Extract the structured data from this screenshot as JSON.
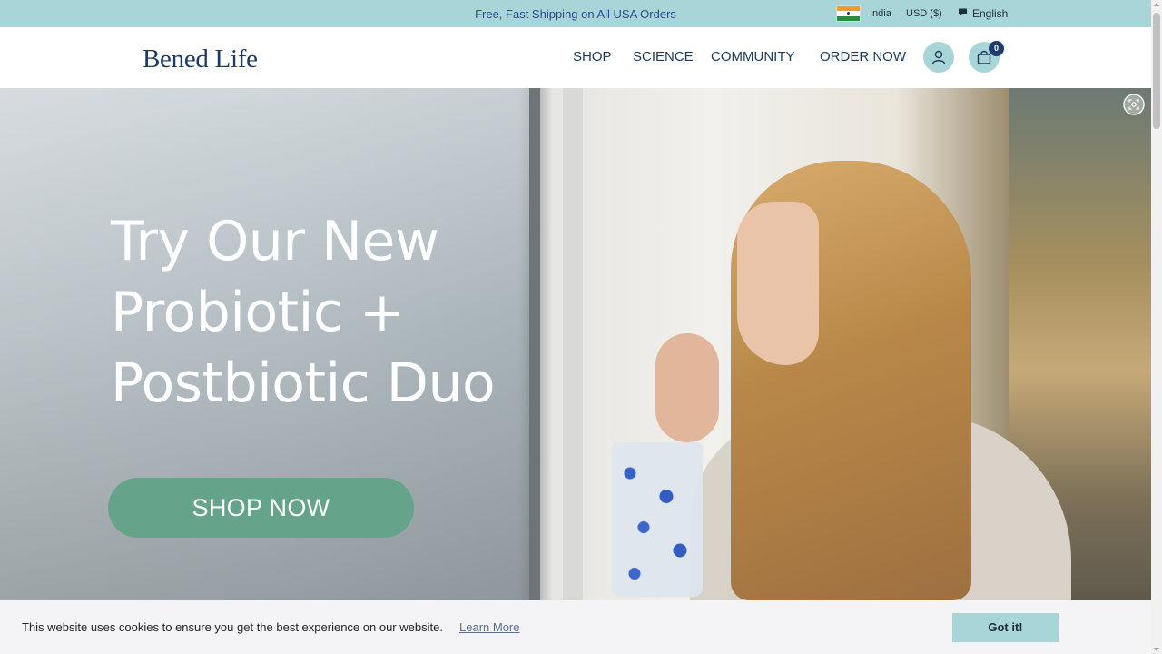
{
  "topbar": {
    "promo": "Free, Fast Shipping on All USA Orders",
    "country": "India",
    "currency": "USD ($)",
    "language": "English",
    "flag_icon": "india-flag-icon",
    "language_icon": "speech-bubble-icon",
    "background_color": "#a8d6d8"
  },
  "header": {
    "logo": "Bened Life",
    "nav": {
      "shop": "SHOP",
      "science": "SCIENCE",
      "community": "COMMUNITY",
      "order_now": "ORDER NOW"
    },
    "account_icon": "user-icon",
    "cart_icon": "shopping-bag-icon",
    "cart_count": "0"
  },
  "hero": {
    "title_lines": [
      "Try Our New",
      "Probiotic +",
      "Postbiotic Duo"
    ],
    "cta": "SHOP NOW",
    "cta_color": "#65a48a",
    "lens_icon": "visual-search-icon"
  },
  "cookie_banner": {
    "message": "This website uses cookies to ensure you get the best experience on our website.",
    "learn_more": "Learn More",
    "accept": "Got it!"
  }
}
